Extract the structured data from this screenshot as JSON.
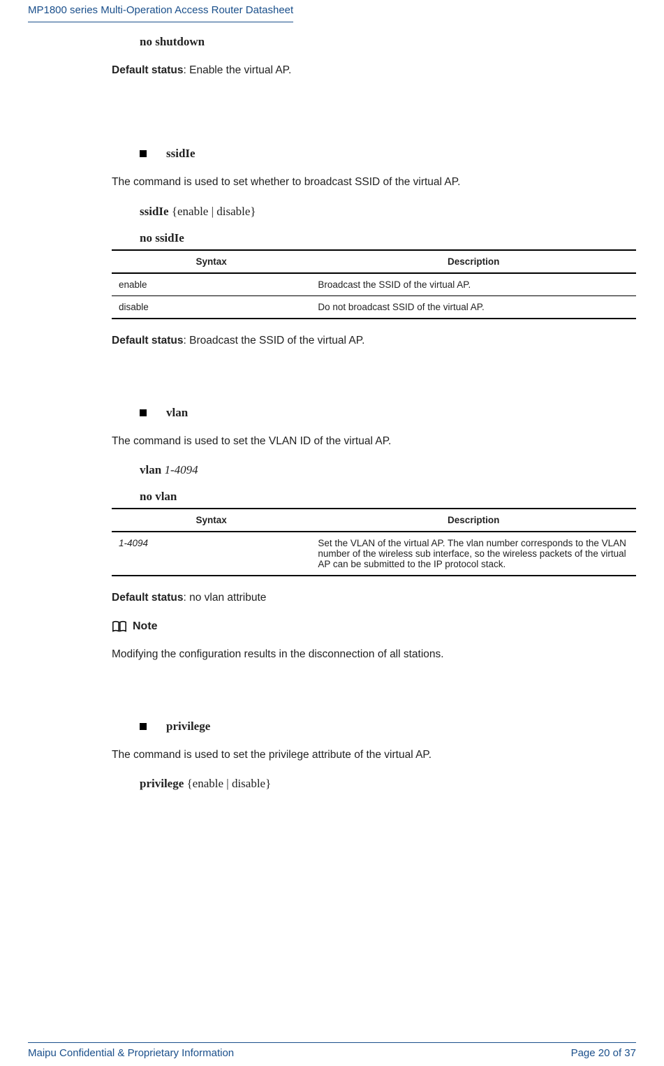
{
  "header": {
    "title": "MP1800 series Multi-Operation Access Router Datasheet"
  },
  "sec_shutdown": {
    "no_cmd": "no shutdown",
    "default_label": "Default status",
    "default_text": ": Enable the virtual AP."
  },
  "sec_ssidie": {
    "heading": "ssidIe",
    "intro": "The command is used to set whether to broadcast SSID of the virtual AP.",
    "cmd_name": "ssidIe ",
    "cmd_args": "{enable | disable}",
    "no_cmd": "no ssidIe",
    "table": {
      "col1": "Syntax",
      "col2": "Description",
      "rows": [
        {
          "syntax": "enable",
          "desc": "Broadcast the SSID of the virtual AP."
        },
        {
          "syntax": "disable",
          "desc": "Do not broadcast SSID of the virtual AP."
        }
      ]
    },
    "default_label": "Default status",
    "default_text": ": Broadcast the SSID of the virtual AP."
  },
  "sec_vlan": {
    "heading": "vlan",
    "intro": "The command is used to set the VLAN ID of the virtual AP.",
    "cmd_name": "vlan ",
    "cmd_args": "1-4094",
    "no_cmd": "no vlan",
    "table": {
      "col1": "Syntax",
      "col2": "Description",
      "rows": [
        {
          "syntax": "1-4094",
          "desc": "Set the VLAN of the virtual AP. The vlan number corresponds to the VLAN number of the wireless sub interface, so the wireless packets of the virtual AP can be submitted to the IP protocol stack."
        }
      ]
    },
    "default_label": "Default status",
    "default_text": ": no vlan attribute",
    "note_label": "Note",
    "note_text": "Modifying the configuration results in the disconnection of all stations."
  },
  "sec_priv": {
    "heading": "privilege",
    "intro": "The command is used to set the privilege attribute of the virtual AP.",
    "cmd_name": "privilege ",
    "cmd_args": "{enable | disable}"
  },
  "footer": {
    "left": "Maipu Confidential & Proprietary Information",
    "right": "Page 20 of 37"
  }
}
